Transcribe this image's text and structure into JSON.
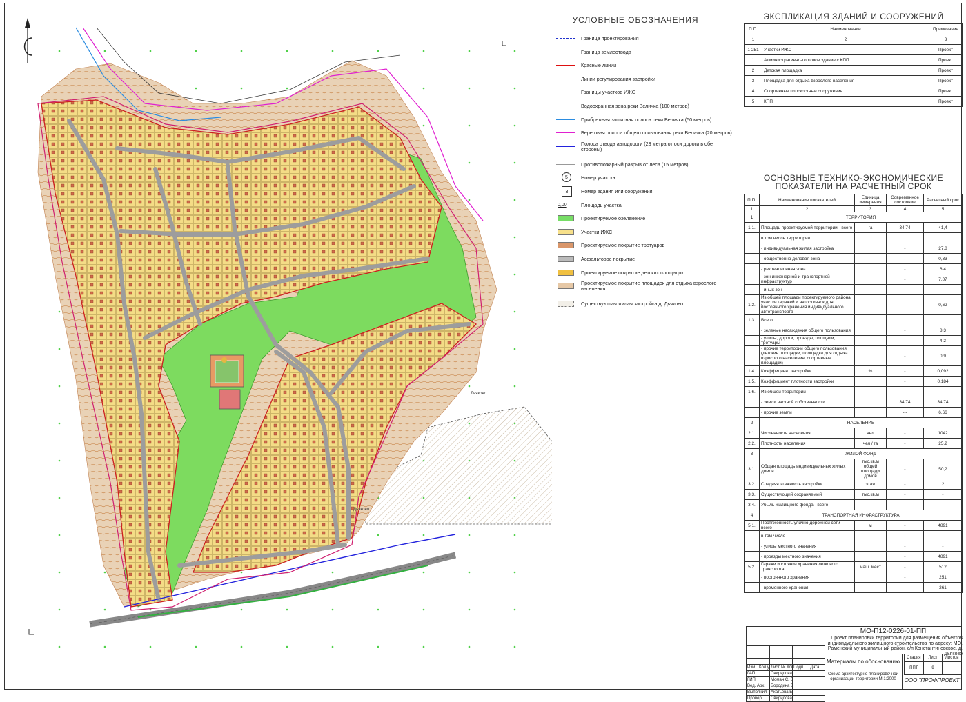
{
  "legend": {
    "title": "УСЛОВНЫЕ ОБОЗНАЧЕНИЯ",
    "items": [
      {
        "label": "Граница проектирования",
        "kind": "line",
        "color": "#2233cc",
        "style": "dashdot"
      },
      {
        "label": "Граница землеотвода",
        "kind": "line",
        "color": "#e03060",
        "style": "solid"
      },
      {
        "label": "Красные линии",
        "kind": "line",
        "color": "#dd1111",
        "style": "thick"
      },
      {
        "label": "Линии регулирования застройки",
        "kind": "line",
        "color": "#888888",
        "style": "dash"
      },
      {
        "label": "Границы участков ИЖС",
        "kind": "line",
        "color": "#555555",
        "style": "dots"
      },
      {
        "label": "Водоохранная зона реки Величка (100 метров)",
        "kind": "line",
        "color": "#333333",
        "style": "solid"
      },
      {
        "label": "Прибрежная защитная полоса реки Величка (50 метров)",
        "kind": "line",
        "color": "#2b8ce0",
        "style": "solid"
      },
      {
        "label": "Береговая полоса общего пользования реки Величка (20 метров)",
        "kind": "line",
        "color": "#e020d0",
        "style": "solid"
      },
      {
        "label": "Полоса отвода автодороги (23 метра от оси дороги в обе стороны)",
        "kind": "line",
        "color": "#2222dd",
        "style": "solid"
      },
      {
        "label": "Противопожарный разрыв от леса (15 метров)",
        "kind": "line",
        "color": "#999999",
        "style": "thin"
      },
      {
        "label": "Номер участка",
        "kind": "circle",
        "value": "5"
      },
      {
        "label": "Номер здания или сооружения",
        "kind": "square",
        "value": "3"
      },
      {
        "label": "Площадь участка",
        "kind": "num",
        "value": "0,00"
      },
      {
        "label": "Проектируемое озеленение",
        "kind": "box",
        "color": "#77dd66"
      },
      {
        "label": "Участки ИЖС",
        "kind": "box",
        "color": "#f7e08a"
      },
      {
        "label": "Проектируемое покрытие тротуаров",
        "kind": "box",
        "color": "#d9966a"
      },
      {
        "label": "Асфальтовое покрытие",
        "kind": "box",
        "color": "#bbbbbb"
      },
      {
        "label": "Проектируемое покрытие детских площадок",
        "kind": "box",
        "color": "#f0c040"
      },
      {
        "label": "Проектируемое покрытие площадок для отдыха взрослого населения",
        "kind": "box",
        "color": "#e6c8a6"
      },
      {
        "label": "Существующая жилая застройка д. Дьяково",
        "kind": "box",
        "color": "#f2efe8"
      }
    ]
  },
  "explication": {
    "title": "ЭКСПЛИКАЦИЯ ЗДАНИЙ И СООРУЖЕНИЙ",
    "headers": [
      "П.П.",
      "Наименование",
      "Примечание"
    ],
    "numbers": [
      "1",
      "2",
      "3"
    ],
    "rows": [
      [
        "1-251",
        "Участки ИЖС",
        "Проект"
      ],
      [
        "1",
        "Административно-торговое здание с КПП",
        "Проект"
      ],
      [
        "2",
        "Детская площадка",
        "Проект"
      ],
      [
        "3",
        "Площадка для отдыха взрослого населения",
        "Проект"
      ],
      [
        "4",
        "Спортивные плоскостные сооружения",
        "Проект"
      ],
      [
        "5",
        "КПП",
        "Проект"
      ]
    ]
  },
  "indicators": {
    "title": "ОСНОВНЫЕ ТЕХНИКО-ЭКОНОМИЧЕСКИЕ ПОКАЗАТЕЛИ НА РАСЧЕТНЫЙ СРОК",
    "headers": [
      "П.П.",
      "Наименование показателей",
      "Единица измерения",
      "Современное состояние",
      "Расчетный срок"
    ],
    "numbers": [
      "1",
      "2",
      "3",
      "4",
      "5"
    ],
    "rows": [
      [
        "1",
        "ТЕРРИТОРИЯ",
        "",
        "",
        "",
        "sec"
      ],
      [
        "1.1.",
        "Площадь проектируемой территории - всего",
        "га",
        "34,74",
        "41,4",
        "first"
      ],
      [
        "",
        "в том числе территории",
        "",
        "",
        "",
        ""
      ],
      [
        "",
        "- индивидуальная жилая застройка",
        "",
        "-",
        "27,8",
        ""
      ],
      [
        "",
        "- общественно деловая зона",
        "",
        "-",
        "0,33",
        ""
      ],
      [
        "",
        "- рекреационная зона",
        "",
        "-",
        "6,4",
        ""
      ],
      [
        "",
        "- зон инженерной и транспортной инфраструктур",
        "",
        "-",
        "7,07",
        ""
      ],
      [
        "",
        "- иных зон",
        "",
        "-",
        "-",
        ""
      ],
      [
        "1.2.",
        "Из общей площади проектируемого района участки гаражей и автостоянок для постоянного хранения индивидуального автотранспорта",
        "",
        "-",
        "0,62",
        "tall"
      ],
      [
        "1.3.",
        "Всего",
        "",
        "",
        "",
        ""
      ],
      [
        "",
        "- зеленые насаждения общего пользования",
        "",
        "-",
        "8,3",
        ""
      ],
      [
        "",
        "- улицы, дороги, проезды, площади, тротуары",
        "",
        "-",
        "4,2",
        ""
      ],
      [
        "",
        "- прочие территории общего пользования (детские площадки, площадки для отдыха взрослого населения, спортивные площадки)",
        "",
        "-",
        "0,9",
        "tall"
      ],
      [
        "1.4.",
        "Коэффициент застройки",
        "%",
        "-",
        "0,092",
        ""
      ],
      [
        "1.5.",
        "Коэффициент плотности застройки",
        "",
        "-",
        "0,184",
        ""
      ],
      [
        "1.6.",
        "Из общей территории",
        "",
        "",
        "",
        ""
      ],
      [
        "",
        "- земли частной собственности",
        "",
        "34,74",
        "34,74",
        ""
      ],
      [
        "",
        "- прочие земли",
        "",
        "---",
        "6,66",
        ""
      ],
      [
        "2",
        "НАСЕЛЕНИЕ",
        "",
        "",
        "",
        "sec"
      ],
      [
        "2.1.",
        "Численность населения",
        "чел",
        "-",
        "1042",
        ""
      ],
      [
        "2.2.",
        "Плотность населения",
        "чел / га",
        "-",
        "25,2",
        ""
      ],
      [
        "3",
        "ЖИЛОЙ ФОНД",
        "",
        "",
        "",
        "sec"
      ],
      [
        "3.1.",
        "Общая площадь индивидуальных жилых домов",
        "тыс.кв.м общей площади домов",
        "-",
        "50,2",
        "tall"
      ],
      [
        "3.2.",
        "Средняя этажность застройки",
        "этаж",
        "-",
        "2",
        ""
      ],
      [
        "3.3.",
        "Существующий сохраняемый",
        "тыс.кв.м",
        "-",
        "-",
        ""
      ],
      [
        "3.4.",
        "Убыль жилищного фонда - всего",
        "",
        "-",
        "-",
        ""
      ],
      [
        "4",
        "ТРАНСПОРТНАЯ ИНФРАСТРУКТУРА",
        "",
        "",
        "",
        "sec"
      ],
      [
        "5.1.",
        "Протяженность улично-дорожной сети - всего",
        "м",
        "-",
        "4891",
        ""
      ],
      [
        "",
        "в том числе",
        "",
        "",
        "",
        ""
      ],
      [
        "",
        "- улицы местного значения",
        "",
        "-",
        "-",
        ""
      ],
      [
        "",
        "- проезды местного значения",
        "",
        "-",
        "4891",
        ""
      ],
      [
        "5.2.",
        "Гаражи и стоянки хранения легкового транспорта",
        "маш. мест",
        "-",
        "512",
        ""
      ],
      [
        "",
        "- постоянного хранения",
        "",
        "-",
        "251",
        ""
      ],
      [
        "",
        "- временного хранения",
        "",
        "-",
        "261",
        ""
      ]
    ]
  },
  "map_labels": {
    "dyakovo_1": "Дьяково",
    "dyakovo_2": "Дьяково"
  },
  "stamp": {
    "code": "МО-П12-0226-01-ПП",
    "project": "Проект планировки территории для размещения объектов индивидуального жилищного строительства по адресу: МО, Раменский муниципальный район, с/п Константиновское, д. Дьяково",
    "head": [
      "Изм.",
      "Кол.уч",
      "Лист",
      "№ док.",
      "Подп.",
      "Дата"
    ],
    "people": [
      [
        "ГАП",
        "Свиридова А.В."
      ],
      [
        "ГИП",
        "Моман С. В."
      ],
      [
        "Вед. Арх.",
        "Бородина Е.В."
      ],
      [
        "Выполнил",
        "Акатьева Е.Е."
      ],
      [
        "Провер.",
        "Свиридова А.В."
      ]
    ],
    "materials": "Материалы по обоснованию",
    "stage_head": [
      "Стадия",
      "Лист",
      "Листов"
    ],
    "stage_vals": [
      "ППТ",
      "9",
      ""
    ],
    "sheet_name": "Схема архитектурно-планировочной организации территории М 1:2000",
    "org": "ООО \"ПРОФПРОЕКТ\""
  }
}
